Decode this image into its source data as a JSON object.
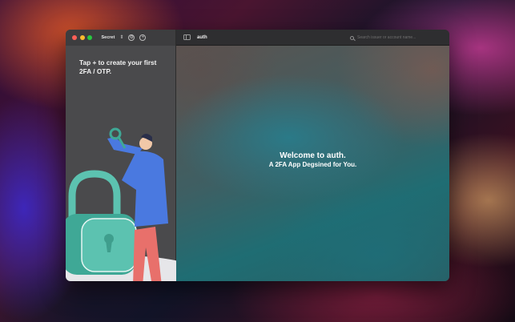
{
  "window": {
    "vault_name": "Secret",
    "sidebar_hint": "Tap + to create your first 2FA / OTP."
  },
  "toolbar": {
    "title": "auth",
    "search_placeholder": "Search issuer or account name..."
  },
  "content": {
    "welcome_title": "Welcome to auth.",
    "welcome_subtitle": "A 2FA App Degsined for You."
  },
  "icons": {
    "vault_chevron": "chevron-up-down-icon",
    "settings": "settings-icon",
    "add": "plus-circle-icon",
    "sidebar_toggle": "sidebar-toggle-icon",
    "search": "search-icon"
  },
  "colors": {
    "close": "#ff5f57",
    "minimize": "#febc2e",
    "zoom": "#28c840",
    "lock": "#5cc2b0",
    "shirt": "#4a79e0",
    "pants": "#e8706b"
  }
}
